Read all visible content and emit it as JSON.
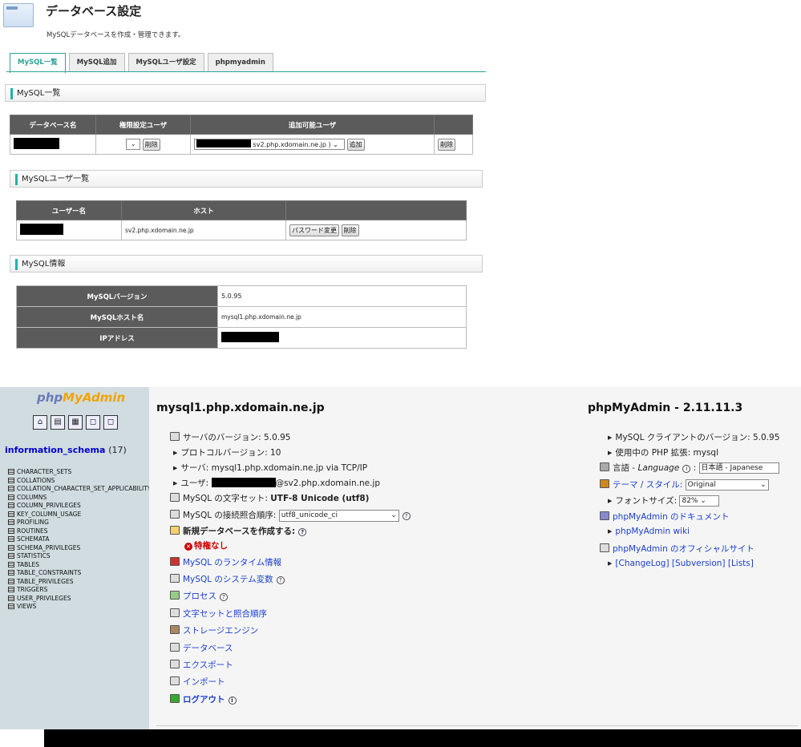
{
  "header": {
    "title": "データベース設定",
    "subtitle": "MySQLデータベースを作成・管理できます。"
  },
  "tabs": [
    "MySQL一覧",
    "MySQL追加",
    "MySQLユーザ設定",
    "phpmyadmin"
  ],
  "sections": {
    "mysql_list": "MySQL一覧",
    "user_list": "MySQLユーザ一覧",
    "info": "MySQL情報"
  },
  "db_table": {
    "headers": [
      "データベース名",
      "権限設定ユーザ",
      "追加可能ユーザ",
      ""
    ],
    "delete_label": "削除",
    "add_label": "追加",
    "select_suffix": "sv2.php.xdomain.ne.jp )"
  },
  "user_table": {
    "headers": [
      "ユーザー名",
      "ホスト",
      ""
    ],
    "host": "sv2.php.xdomain.ne.jp",
    "password_label": "パスワード変更",
    "delete_label": "削除"
  },
  "info_table": {
    "rows": [
      {
        "key": "MySQLバージョン",
        "value": "5.0.95"
      },
      {
        "key": "MySQLホスト名",
        "value": "mysql1.php.xdomain.ne.jp"
      },
      {
        "key": "IPアドレス",
        "value": ""
      }
    ]
  },
  "pma": {
    "logo_a": "php",
    "logo_b": "MyAdmin",
    "db_name": "information_schema",
    "db_count": "(17)",
    "tables": [
      "CHARACTER_SETS",
      "COLLATIONS",
      "COLLATION_CHARACTER_SET_APPLICABILITY",
      "COLUMNS",
      "COLUMN_PRIVILEGES",
      "KEY_COLUMN_USAGE",
      "PROFILING",
      "ROUTINES",
      "SCHEMATA",
      "SCHEMA_PRIVILEGES",
      "STATISTICS",
      "TABLES",
      "TABLE_CONSTRAINTS",
      "TABLE_PRIVILEGES",
      "TRIGGERS",
      "USER_PRIVILEGES",
      "VIEWS"
    ],
    "server_title": "mysql1.php.xdomain.ne.jp",
    "server_version": "サーバのバージョン: 5.0.95",
    "protocol": "プロトコルバージョン: 10",
    "server": "サーバ: mysql1.php.xdomain.ne.jp via TCP/IP",
    "user_label": "ユーザ:",
    "user_host": "@sv2.php.xdomain.ne.jp",
    "charset_label": "MySQL の文字セット:",
    "charset_value": "UTF-8 Unicode (utf8)",
    "collation_label": "MySQL の接続照合順序:",
    "collation_value": "utf8_unicode_ci",
    "create_db": "新規データベースを作成する:",
    "no_privileges": "特権なし",
    "runtime_info": "MySQL のランタイム情報",
    "system_vars": "MySQL のシステム変数",
    "processes": "プロセス",
    "charsets": "文字セットと照合順序",
    "engines": "ストレージエンジン",
    "databases": "データベース",
    "export": "エクスポート",
    "import": "インポート",
    "logout": "ログアウト",
    "pma_title": "phpMyAdmin - 2.11.11.3",
    "client_version": "MySQL クライアントのバージョン: 5.0.95",
    "php_ext": "使用中の PHP 拡張: mysql",
    "language_label": "言語 - ",
    "language_word": "Language",
    "language_value": "日本語 - Japanese",
    "theme_label": "テーマ / スタイル:",
    "theme_value": "Original",
    "font_size_label": "フォントサイズ:",
    "font_size_value": "82%",
    "docs": "phpMyAdmin のドキュメント",
    "wiki": "phpMyAdmin wiki",
    "official": "phpMyAdmin のオフィシャルサイト",
    "changelog": "[ChangeLog] [Subversion] [Lists]"
  }
}
